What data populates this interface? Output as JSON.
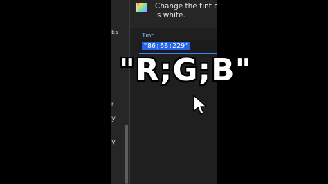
{
  "sidebar": {
    "section_label": "ES",
    "mark": "r",
    "line_a": "y",
    "line_b": "y"
  },
  "tip": {
    "text_line1": "Change the tint of a",
    "text_line2": "is white."
  },
  "tint_field": {
    "label": "Tint",
    "value": "\"86;68;229\""
  },
  "caption": {
    "text": "\"R;G;B\""
  },
  "colors": {
    "accent": "#3b82f6",
    "selection": "#2563eb",
    "panel_bg": "#1f1f1f"
  }
}
